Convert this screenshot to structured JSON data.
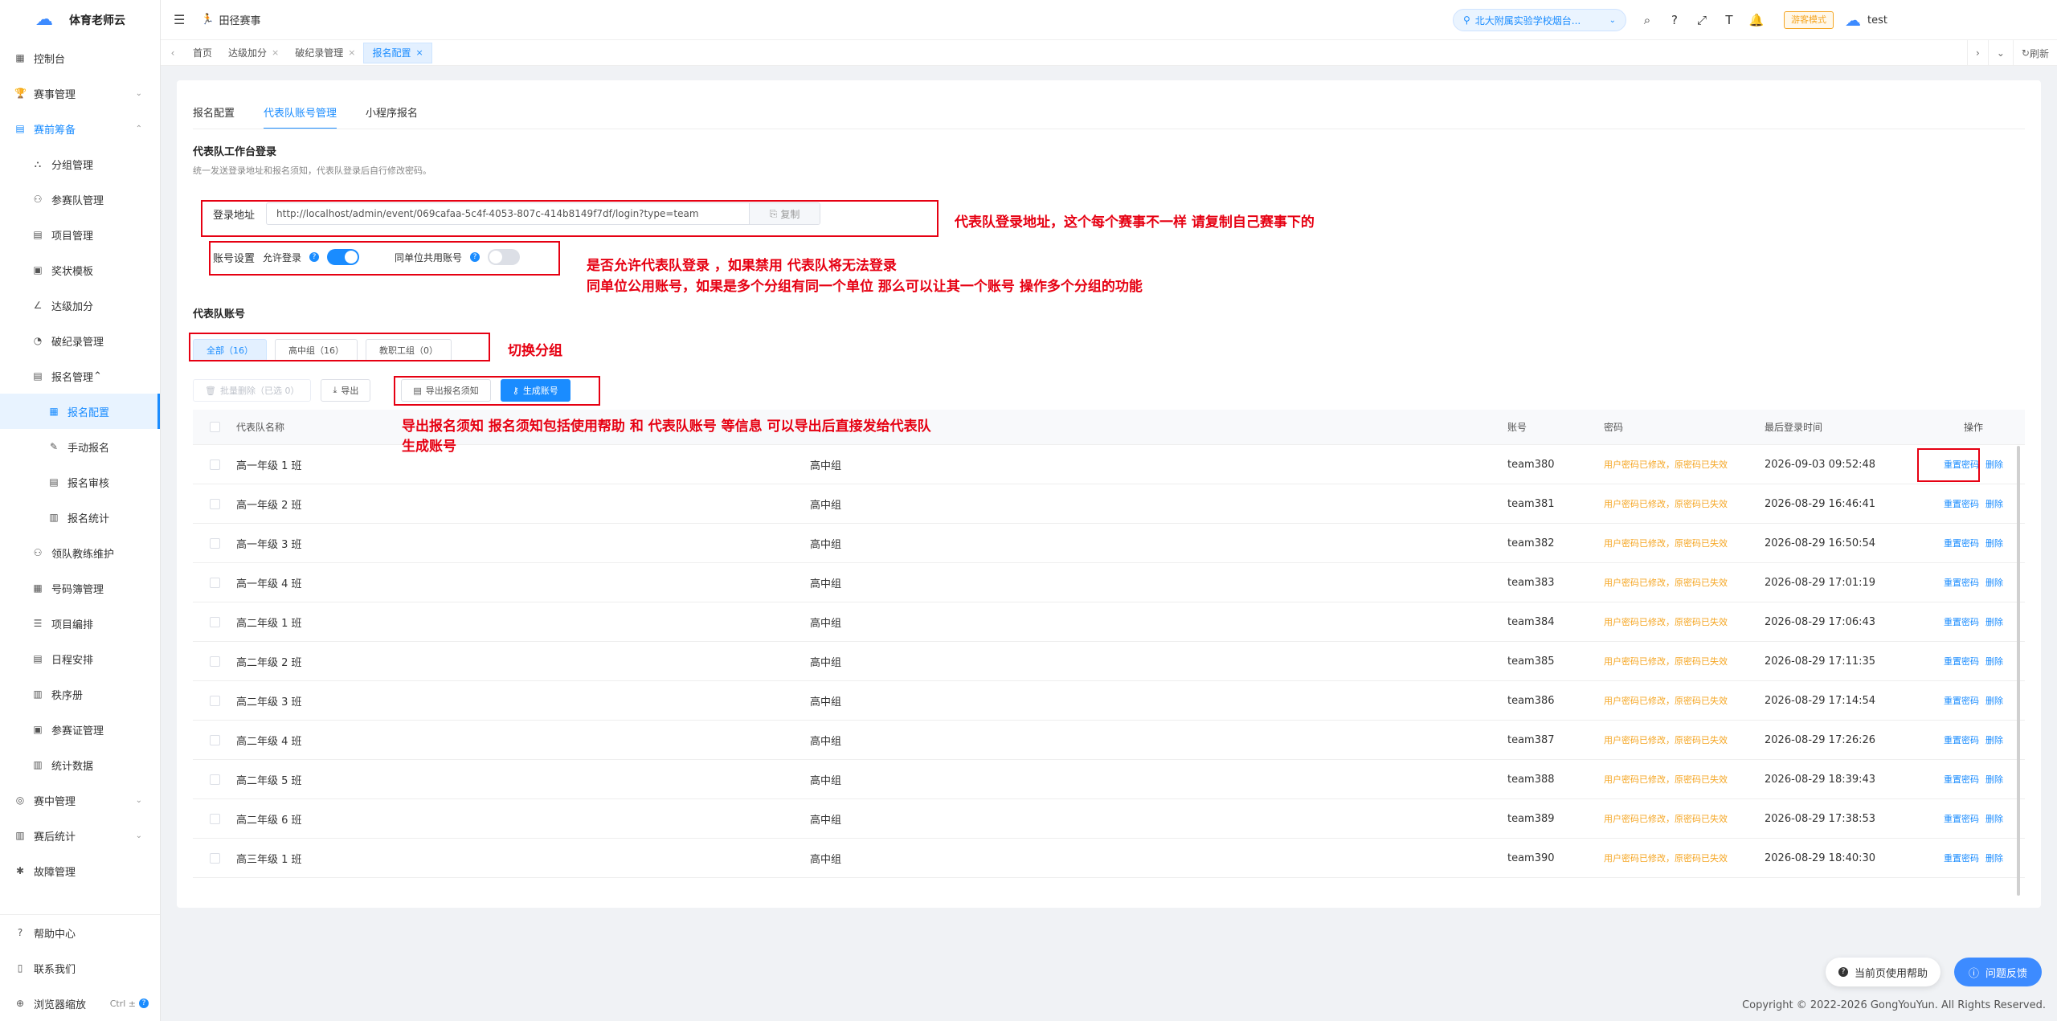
{
  "app": {
    "name": "体育老师云"
  },
  "sidebar": {
    "items": [
      {
        "label": "控制台",
        "icon": "dashboard-icon"
      },
      {
        "label": "赛事管理",
        "icon": "trophy-icon"
      },
      {
        "label": "赛前筹备",
        "icon": "doc-icon"
      },
      {
        "label": "分组管理",
        "icon": "group-icon"
      },
      {
        "label": "参赛队管理",
        "icon": "team-icon"
      },
      {
        "label": "项目管理",
        "icon": "list-icon"
      },
      {
        "label": "奖状模板",
        "icon": "certificate-icon"
      },
      {
        "label": "达级加分",
        "icon": "chart-icon"
      },
      {
        "label": "破纪录管理",
        "icon": "record-icon"
      },
      {
        "label": "报名管理",
        "icon": "signup-icon"
      },
      {
        "label": "报名配置",
        "icon": "config-icon"
      },
      {
        "label": "手动报名",
        "icon": "manual-icon"
      },
      {
        "label": "报名审核",
        "icon": "audit-icon"
      },
      {
        "label": "报名统计",
        "icon": "stats-icon"
      },
      {
        "label": "领队教练维护",
        "icon": "coach-icon"
      },
      {
        "label": "号码簿管理",
        "icon": "number-icon"
      },
      {
        "label": "项目编排",
        "icon": "arrange-icon"
      },
      {
        "label": "日程安排",
        "icon": "calendar-icon"
      },
      {
        "label": "秩序册",
        "icon": "book-icon"
      },
      {
        "label": "参赛证管理",
        "icon": "card-icon"
      },
      {
        "label": "统计数据",
        "icon": "bar-chart-icon"
      },
      {
        "label": "赛中管理",
        "icon": "live-icon"
      },
      {
        "label": "赛后统计",
        "icon": "post-stats-icon"
      },
      {
        "label": "故障管理",
        "icon": "bug-icon"
      }
    ],
    "bottom": {
      "help": "帮助中心",
      "contact": "联系我们",
      "zoom": "浏览器缩放",
      "zoom_shortcut": "Ctrl ±"
    }
  },
  "header": {
    "title": "田径赛事",
    "school": "北大附属实验学校烟台...",
    "guest_mode": "游客模式",
    "user": "test"
  },
  "tabs": [
    {
      "label": "首页"
    },
    {
      "label": "达级加分"
    },
    {
      "label": "破纪录管理"
    },
    {
      "label": "报名配置"
    }
  ],
  "tabs_refresh": "刷新",
  "inner_tabs": [
    "报名配置",
    "代表队账号管理",
    "小程序报名"
  ],
  "workbench": {
    "title": "代表队工作台登录",
    "desc": "统一发送登录地址和报名须知，代表队登录后自行修改密码。",
    "url_label": "登录地址",
    "url": "http://localhost/admin/event/069cafaa-5c4f-4053-807c-414b8149f7df/login?type=team",
    "copy": "复制",
    "acct_label": "账号设置",
    "allow_login": "允许登录",
    "share_account": "同单位共用账号",
    "allow_login_on": true,
    "share_account_on": false
  },
  "accounts": {
    "title": "代表队账号",
    "groups": [
      "全部（16）",
      "高中组（16）",
      "教职工组（0）"
    ],
    "buttons": {
      "batch_delete": "批量删除（已选 0）",
      "export": "导出",
      "export_notice": "导出报名须知",
      "generate": "生成账号"
    },
    "columns": [
      "代表队名称",
      "账号",
      "密码",
      "最后登录时间",
      "操作"
    ],
    "rows": [
      {
        "name": "高一年级 1 班",
        "group": "高中组",
        "account": "team380",
        "password": "用户密码已修改，原密码已失效",
        "last_login": "2026-09-03 09:52:48"
      },
      {
        "name": "高一年级 2 班",
        "group": "高中组",
        "account": "team381",
        "password": "用户密码已修改，原密码已失效",
        "last_login": "2026-08-29 16:46:41"
      },
      {
        "name": "高一年级 3 班",
        "group": "高中组",
        "account": "team382",
        "password": "用户密码已修改，原密码已失效",
        "last_login": "2026-08-29 16:50:54"
      },
      {
        "name": "高一年级 4 班",
        "group": "高中组",
        "account": "team383",
        "password": "用户密码已修改，原密码已失效",
        "last_login": "2026-08-29 17:01:19"
      },
      {
        "name": "高二年级 1 班",
        "group": "高中组",
        "account": "team384",
        "password": "用户密码已修改，原密码已失效",
        "last_login": "2026-08-29 17:06:43"
      },
      {
        "name": "高二年级 2 班",
        "group": "高中组",
        "account": "team385",
        "password": "用户密码已修改，原密码已失效",
        "last_login": "2026-08-29 17:11:35"
      },
      {
        "name": "高二年级 3 班",
        "group": "高中组",
        "account": "team386",
        "password": "用户密码已修改，原密码已失效",
        "last_login": "2026-08-29 17:14:54"
      },
      {
        "name": "高二年级 4 班",
        "group": "高中组",
        "account": "team387",
        "password": "用户密码已修改，原密码已失效",
        "last_login": "2026-08-29 17:26:26"
      },
      {
        "name": "高二年级 5 班",
        "group": "高中组",
        "account": "team388",
        "password": "用户密码已修改，原密码已失效",
        "last_login": "2026-08-29 18:39:43"
      },
      {
        "name": "高二年级 6 班",
        "group": "高中组",
        "account": "team389",
        "password": "用户密码已修改，原密码已失效",
        "last_login": "2026-08-29 17:38:53"
      },
      {
        "name": "高三年级 1 班",
        "group": "高中组",
        "account": "team390",
        "password": "用户密码已修改，原密码已失效",
        "last_login": "2026-08-29 18:40:30"
      }
    ],
    "ops": [
      "重置密码",
      "删除"
    ]
  },
  "annotations": {
    "url_note": "代表队登录地址，这个每个赛事不一样 请复制自己赛事下的",
    "settings_note_1": "是否允许代表队登录 ，如果禁用 代表队将无法登录",
    "settings_note_2": "同单位公用账号，如果是多个分组有同一个单位 那么可以让其一个账号 操作多个分组的功能",
    "group_note": "切换分组",
    "export_note_1": "导出报名须知 报名须知包括使用帮助 和 代表队账号 等信息 可以导出后直接发给代表队",
    "export_note_2": "生成账号"
  },
  "footer": {
    "page_help": "当前页使用帮助",
    "feedback": "问题反馈",
    "copyright": "Copyright © 2022-2026 GongYouYun. All Rights Reserved."
  }
}
